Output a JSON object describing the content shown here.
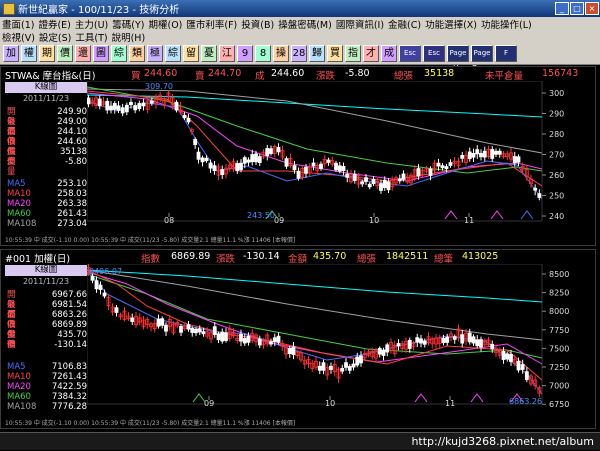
{
  "window": {
    "title": "新世紀贏家 - 100/11/23 - 技術分析",
    "min": "_",
    "max": "□",
    "close": "×"
  },
  "menu": {
    "row1": [
      "畫面(1)",
      "證券(E)",
      "主力(U)",
      "籌碼(Y)",
      "期權(O)",
      "匯市利率(F)",
      "投資(B)",
      "操盤密碼(M)",
      "國際資訊(I)",
      "金融(C)",
      "功能選擇(X)",
      "功能操作(L)"
    ],
    "row2": [
      "檢視(V)",
      "設定(S)",
      "工具(T)",
      "說明(H)"
    ]
  },
  "toolbar": [
    "加",
    "權",
    "期",
    "價",
    "還",
    "圖",
    "綜",
    "類",
    "極",
    "綜",
    "留",
    "憂",
    "江",
    "9",
    "8",
    "操",
    "28",
    "歸",
    "買",
    "指",
    "才",
    "成"
  ],
  "toolbar_wide": [
    "Esc",
    "Esc",
    "Page Up",
    "Page Down",
    "F"
  ],
  "panel1": {
    "symbol": "STWA& 摩台指&(日)",
    "buy_k": "買",
    "buy_v": "244.60",
    "sell_k": "賣",
    "sell_v": "244.70",
    "deal_k": "成",
    "deal_v": "244.60",
    "chg_k": "漲跌",
    "chg_v": "-5.80",
    "vol_k": "總張",
    "vol_v": "35138",
    "oi_k": "未平倉量",
    "oi_v": "156743",
    "ktag": "K線圖",
    "kdate": "2011/11/23",
    "labels": [
      {
        "k": "開盤價",
        "v": "249.90",
        "c": "#ff5050"
      },
      {
        "k": "最高價",
        "v": "249.00",
        "c": "#ff5050"
      },
      {
        "k": "最低價",
        "v": "244.10",
        "c": "#ff5050"
      },
      {
        "k": "收盤價",
        "v": "244.60",
        "c": "#ff5050"
      },
      {
        "k": "成交量",
        "v": "35138",
        "c": "#ff5050"
      },
      {
        "k": "差",
        "v": "-5.80",
        "c": "#ff5050"
      },
      {
        "k": "MA5",
        "v": "253.10",
        "c": "#4a6cff"
      },
      {
        "k": "MA10",
        "v": "258.03",
        "c": "#ff4040"
      },
      {
        "k": "MA20",
        "v": "263.38",
        "c": "#ff40ff"
      },
      {
        "k": "MA60",
        "v": "261.43",
        "c": "#40d040"
      },
      {
        "k": "MA108",
        "v": "273.04",
        "c": "#a0a0a0"
      }
    ],
    "hi": "309.70",
    "lo": "243.50",
    "yticks": [
      "300",
      "290",
      "280",
      "270",
      "260",
      "250",
      "240"
    ],
    "xticks": [
      "08",
      "09",
      "10",
      "11"
    ],
    "foot": "10:55:39 中 成交(-1.10 0.00)  10:55:39 中 成交(11/23 -5.80)  成交量2.1 總量11.1 %漲 11406  [本報價]",
    "foot_r": "10:55:39"
  },
  "panel2": {
    "symbol": "#001 加權(日)",
    "idx_k": "指數",
    "idx_v": "6869.89",
    "chg_k": "漲跌",
    "chg_v": "-130.14",
    "amt_k": "金額",
    "amt_v": "435.70",
    "vol_k": "總張",
    "vol_v": "1842511",
    "cnt_k": "總筆",
    "cnt_v": "413025",
    "ktag": "K線圖",
    "kdate": "2011/11/23",
    "labels": [
      {
        "k": "開盤價",
        "v": "6967.66",
        "c": "#ff5050"
      },
      {
        "k": "最高價",
        "v": "6981.54",
        "c": "#ff5050"
      },
      {
        "k": "最低價",
        "v": "6863.26",
        "c": "#ff5050"
      },
      {
        "k": "收盤價",
        "v": "6869.89",
        "c": "#ff5050"
      },
      {
        "k": "金額",
        "v": "435.70",
        "c": "#ff5050"
      },
      {
        "k": "差",
        "v": "-130.14",
        "c": "#ff5050"
      },
      {
        "k": "MA5",
        "v": "7106.83",
        "c": "#4a6cff"
      },
      {
        "k": "MA10",
        "v": "7261.43",
        "c": "#ff4040"
      },
      {
        "k": "MA20",
        "v": "7422.59",
        "c": "#ff40ff"
      },
      {
        "k": "MA60",
        "v": "7384.32",
        "c": "#40d040"
      },
      {
        "k": "MA108",
        "v": "7776.28",
        "c": "#a0a0a0"
      }
    ],
    "hi": "8496.07",
    "lo": "6863.26",
    "yticks": [
      "8500",
      "8250",
      "8000",
      "7750",
      "7500",
      "7250",
      "7000",
      "6750"
    ],
    "xticks": [
      "09",
      "10",
      "11"
    ],
    "foot": "10:55:39 中 成交(-1.10 0.00)  10:55:39 中 成交(11/23 -5.80)  成交量2.1 總量11.1 %漲 11406  [本報價]",
    "foot_r": "10:55:39"
  },
  "status": {
    "url": "http://kujd3268.pixnet.net/album"
  },
  "colors": {
    "up": "#ff3030",
    "down": "#30d0ff",
    "ma5": "#4a6cff",
    "ma10": "#ff4040",
    "ma20": "#ff40ff",
    "ma60": "#40d040",
    "ma108": "#a0a0a0",
    "cyan": "#00ffff"
  }
}
